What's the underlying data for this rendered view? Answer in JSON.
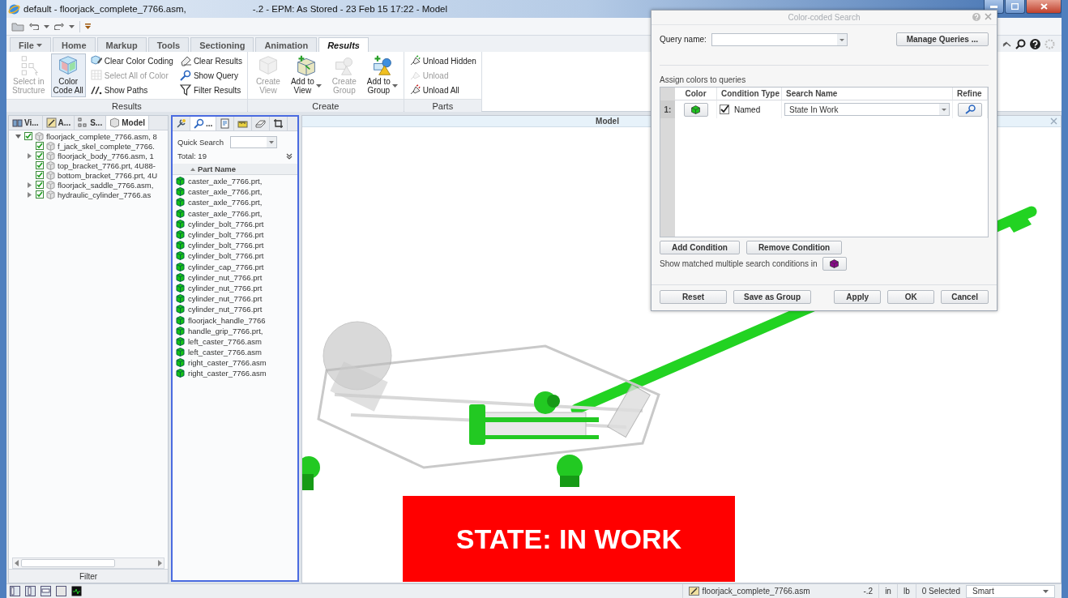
{
  "window": {
    "title": "default - floorjack_complete_7766.asm,",
    "title_suffix": "-.2 - EPM: As Stored - 23 Feb 15 17:22 - Model"
  },
  "ribbon": {
    "tabs": [
      {
        "label": "File",
        "selected": false,
        "dropdown": true
      },
      {
        "label": "Home",
        "selected": false
      },
      {
        "label": "Markup",
        "selected": false
      },
      {
        "label": "Tools",
        "selected": false
      },
      {
        "label": "Sectioning",
        "selected": false
      },
      {
        "label": "Animation",
        "selected": false
      },
      {
        "label": "Results",
        "selected": true
      }
    ],
    "groups": [
      {
        "label": "Results",
        "items": [
          {
            "kind": "large",
            "label": "Select in\nStructure",
            "disabled": true,
            "pressed": false
          },
          {
            "kind": "large",
            "label": "Color\nCode All",
            "disabled": false,
            "pressed": true
          },
          {
            "kind": "small",
            "label": "Clear Color Coding",
            "disabled": false
          },
          {
            "kind": "small",
            "label": "Select All of Color",
            "disabled": true
          },
          {
            "kind": "small",
            "label": "Show Paths",
            "disabled": false
          },
          {
            "kind": "small",
            "label": "Clear Results",
            "disabled": false
          },
          {
            "kind": "small",
            "label": "Show Query",
            "disabled": false
          },
          {
            "kind": "small",
            "label": "Filter Results",
            "disabled": false
          }
        ]
      },
      {
        "label": "Create",
        "items": [
          {
            "kind": "large",
            "label": "Create\nView",
            "disabled": true,
            "pressed": false
          },
          {
            "kind": "large",
            "label": "Add to\nView",
            "disabled": false,
            "pressed": false,
            "dropdown": true
          },
          {
            "kind": "large",
            "label": "Create\nGroup",
            "disabled": true,
            "pressed": false
          },
          {
            "kind": "large",
            "label": "Add to\nGroup",
            "disabled": false,
            "pressed": false,
            "dropdown": true
          }
        ]
      },
      {
        "label": "Parts",
        "items": [
          {
            "kind": "small",
            "label": "Unload Hidden",
            "disabled": false
          },
          {
            "kind": "small",
            "label": "Unload",
            "disabled": true
          },
          {
            "kind": "small",
            "label": "Unload All",
            "disabled": false
          }
        ]
      }
    ]
  },
  "left_panel": {
    "tabs": [
      {
        "label": "Vi...",
        "selected": false
      },
      {
        "label": "A...",
        "selected": false
      },
      {
        "label": "S...",
        "selected": false
      },
      {
        "label": "Model",
        "selected": true
      }
    ],
    "tree": [
      {
        "label": "floorjack_complete_7766.asm, 8",
        "checked": true,
        "expanded": true,
        "children": [
          {
            "label": "f_jack_skel_complete_7766.",
            "checked": true
          },
          {
            "label": "floorjack_body_7766.asm, 1",
            "checked": true,
            "expanded": false
          },
          {
            "label": "top_bracket_7766.prt, 4U88-",
            "checked": true
          },
          {
            "label": "bottom_bracket_7766.prt, 4U",
            "checked": true
          },
          {
            "label": "floorjack_saddle_7766.asm,",
            "checked": true,
            "expanded": false
          },
          {
            "label": "hydraulic_cylinder_7766.as",
            "checked": true,
            "expanded": false
          }
        ]
      }
    ],
    "filter": "Filter"
  },
  "results_panel": {
    "tabs": [
      {
        "selected": false
      },
      {
        "label": "...",
        "selected": true
      },
      {
        "selected": false
      },
      {
        "selected": false
      },
      {
        "selected": false
      },
      {
        "selected": false
      }
    ],
    "quick_search_label": "Quick Search",
    "total": "Total: 19",
    "column": "Part Name",
    "parts": [
      "caster_axle_7766.prt,",
      "caster_axle_7766.prt,",
      "caster_axle_7766.prt,",
      "caster_axle_7766.prt,",
      "cylinder_bolt_7766.prt",
      "cylinder_bolt_7766.prt",
      "cylinder_bolt_7766.prt",
      "cylinder_bolt_7766.prt",
      "cylinder_cap_7766.prt",
      "cylinder_nut_7766.prt",
      "cylinder_nut_7766.prt",
      "cylinder_nut_7766.prt",
      "cylinder_nut_7766.prt",
      "floorjack_handle_7766",
      "handle_grip_7766.prt,",
      "left_caster_7766.asm",
      "left_caster_7766.asm",
      "right_caster_7766.asm",
      "right_caster_7766.asm"
    ]
  },
  "viewport": {
    "title": "Model",
    "banner": "STATE: IN WORK"
  },
  "dialog": {
    "title": "Color-coded Search",
    "query_label": "Query name:",
    "manage_button": "Manage Queries ...",
    "section_label": "Assign colors to queries",
    "columns": [
      "Color",
      "Condition Type",
      "Search Name",
      "Refine"
    ],
    "conditions": [
      {
        "index": "1:",
        "color": "#1fc41f",
        "checked": true,
        "type": "Named",
        "search_name": "State In Work"
      }
    ],
    "condition_buttons": [
      "Add Condition",
      "Remove Condition"
    ],
    "multi_label": "Show matched multiple search conditions in",
    "multi_match": {
      "color": "#8a0a8a"
    },
    "footer_buttons": [
      "Reset",
      "Save as Group",
      "Apply",
      "OK",
      "Cancel"
    ]
  },
  "status_bar": {
    "file": "floorjack_complete_7766.asm",
    "revision": "-.2",
    "length_unit": "in",
    "mass_unit": "lb",
    "selection": "0 Selected",
    "filter": "Smart"
  }
}
